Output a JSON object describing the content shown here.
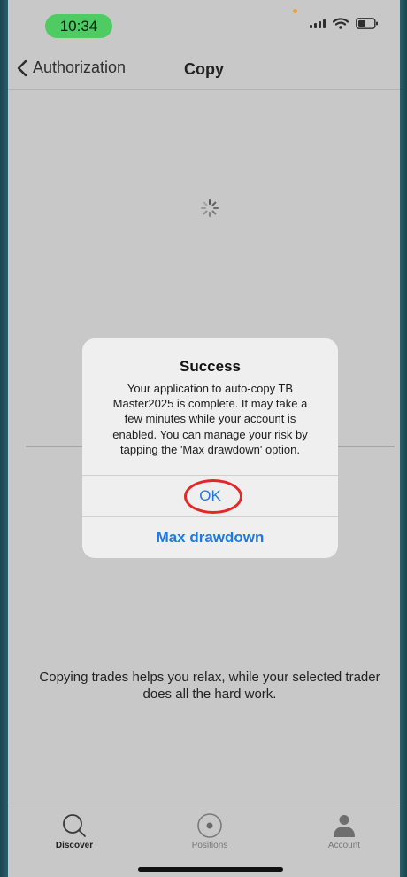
{
  "status_bar": {
    "time": "10:34"
  },
  "nav": {
    "back_label": "Authorization",
    "title": "Copy"
  },
  "alert": {
    "title": "Success",
    "message": "Your application to auto-copy TB Master2025 is complete. It may take a few minutes while your account is enabled. You can manage your risk by tapping the 'Max drawdown' option.",
    "ok_label": "OK",
    "max_drawdown_label": "Max drawdown"
  },
  "body_text": "Copying trades helps you relax, while your selected trader does all the hard work.",
  "tabs": [
    {
      "label": "Discover",
      "icon": "search-icon",
      "active": true
    },
    {
      "label": "Positions",
      "icon": "target-icon",
      "active": false
    },
    {
      "label": "Account",
      "icon": "person-icon",
      "active": false
    }
  ],
  "colors": {
    "accent": "#1f7ae0",
    "highlight": "#e32828",
    "time_pill": "#4ecb62",
    "background": "#c8c8c8"
  }
}
